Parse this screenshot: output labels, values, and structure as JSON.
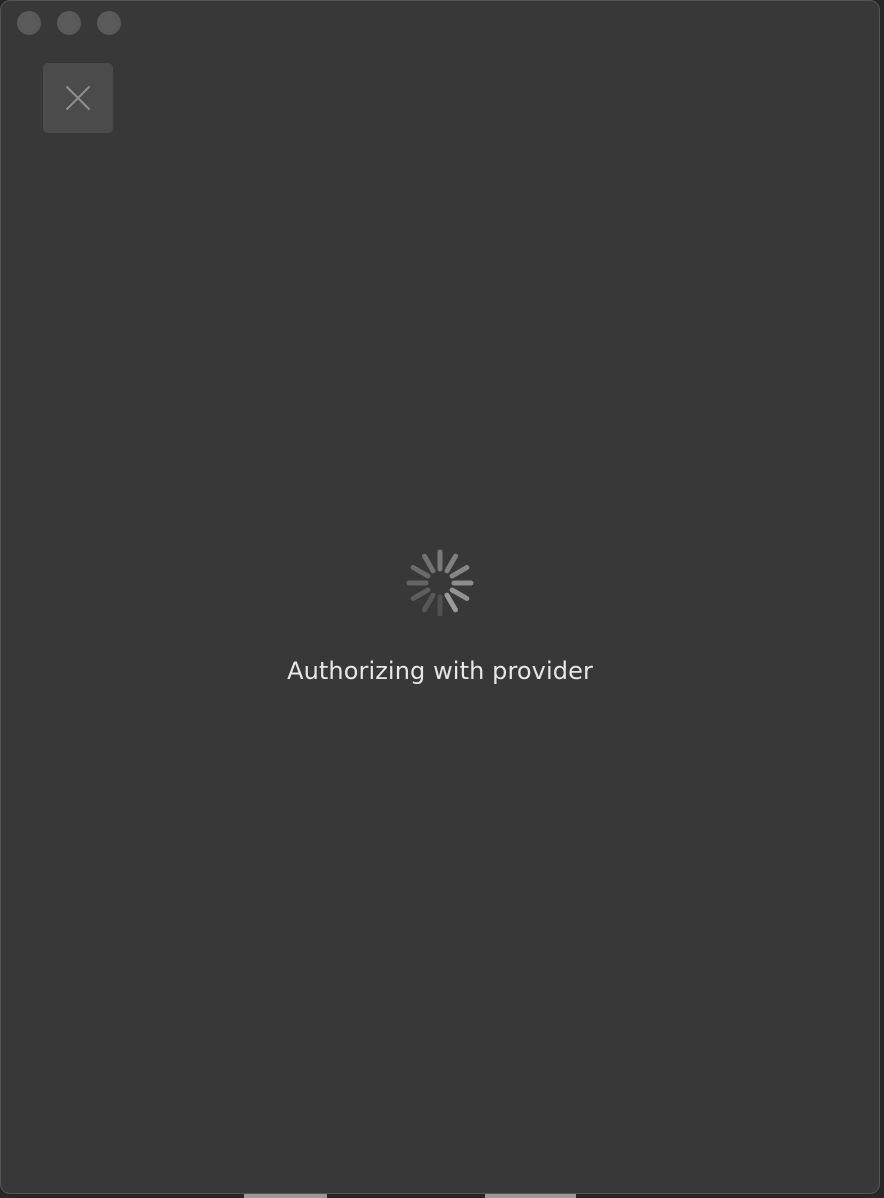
{
  "window": {
    "traffic_lights": [
      "close",
      "minimize",
      "zoom"
    ]
  },
  "toolbar": {
    "close_icon": "close-icon"
  },
  "status": {
    "message": "Authorizing with provider",
    "indicator": "loading-spinner-icon"
  },
  "colors": {
    "window_background": "#383838",
    "button_background": "#4b4b4b",
    "text": "#e6e6e6",
    "spinner": "#9a9a9a"
  }
}
